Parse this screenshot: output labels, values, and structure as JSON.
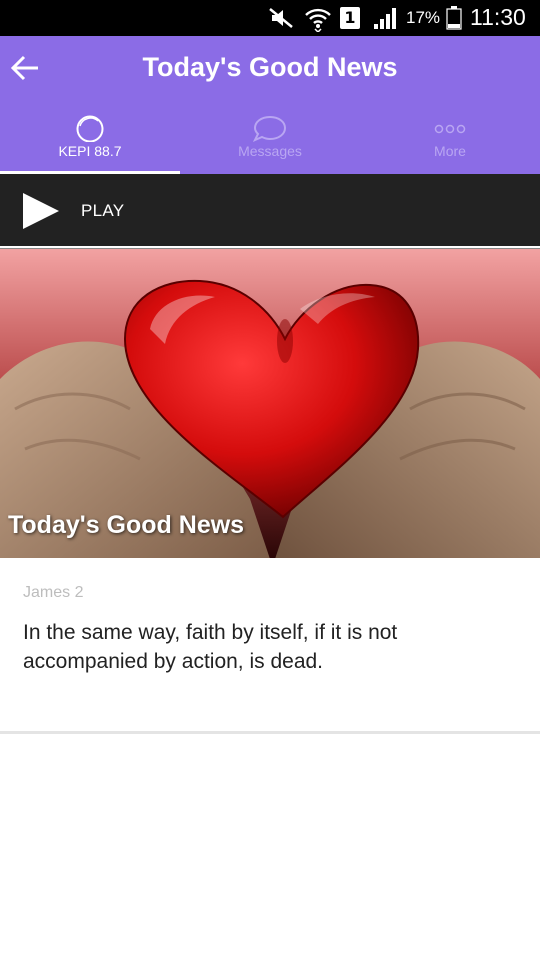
{
  "status_bar": {
    "battery_percent": "17%",
    "time": "11:30",
    "sim_label": "1",
    "icons": [
      "mute-icon",
      "wifi-icon",
      "sim-icon",
      "signal-icon",
      "battery-icon"
    ]
  },
  "app_bar": {
    "title": "Today's Good News",
    "back_icon": "arrow-left-icon",
    "color": "#8b6ce6"
  },
  "tabs": [
    {
      "label": "KEPI 88.7",
      "icon": "radio-circle-icon",
      "active": true
    },
    {
      "label": "Messages",
      "icon": "chat-bubble-icon",
      "active": false
    },
    {
      "label": "More",
      "icon": "more-dots-icon",
      "active": false
    }
  ],
  "player": {
    "label": "PLAY",
    "icon": "play-icon"
  },
  "hero": {
    "title": "Today's Good News",
    "image": "heart-in-hands"
  },
  "verse": {
    "reference": "James 2",
    "text": "In the same way, faith by itself, if it is not accompanied by action, is dead."
  }
}
